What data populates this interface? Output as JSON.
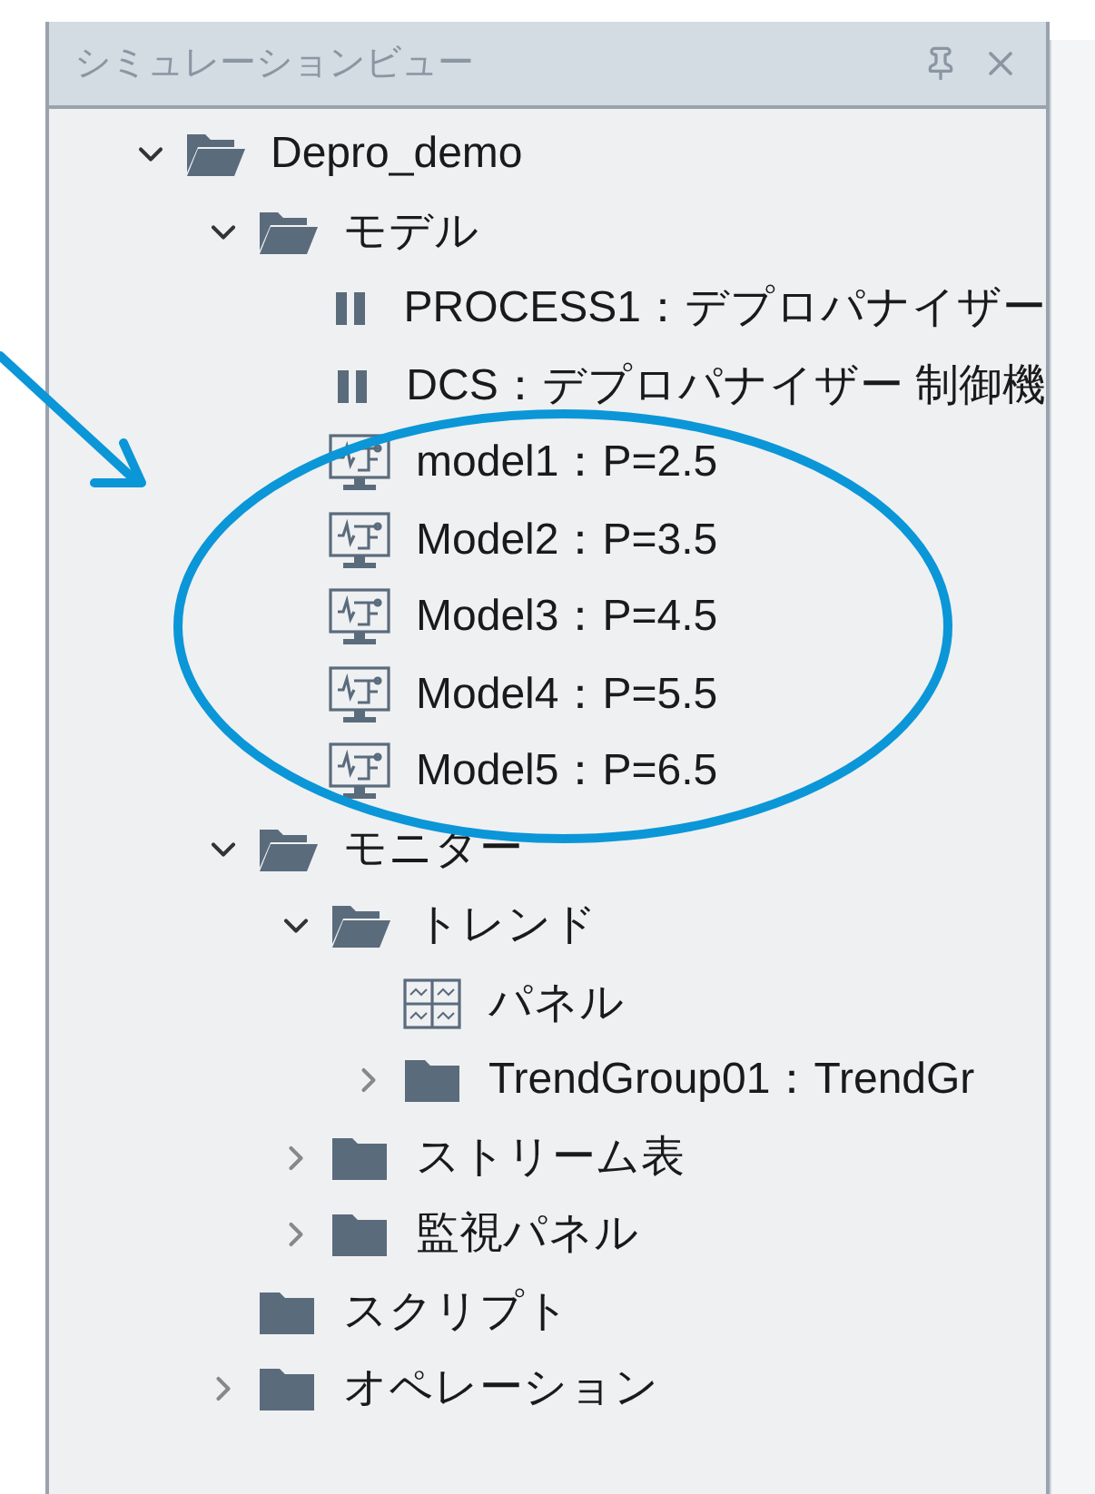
{
  "panel": {
    "title": "シミュレーションビュー"
  },
  "tree": [
    {
      "label": "Depro_demo",
      "kind": "folder",
      "expanded": true,
      "children": [
        {
          "label": "モデル",
          "kind": "folder",
          "expanded": true,
          "children": [
            {
              "label": "PROCESS1：デプロパナイザー",
              "kind": "process"
            },
            {
              "label": "DCS：デプロパナイザー 制御機",
              "kind": "process"
            },
            {
              "label": "model1：P=2.5",
              "kind": "model"
            },
            {
              "label": "Model2：P=3.5",
              "kind": "model"
            },
            {
              "label": "Model3：P=4.5",
              "kind": "model"
            },
            {
              "label": "Model4：P=5.5",
              "kind": "model"
            },
            {
              "label": "Model5：P=6.5",
              "kind": "model"
            }
          ]
        },
        {
          "label": "モニター",
          "kind": "folder",
          "expanded": true,
          "children": [
            {
              "label": "トレンド",
              "kind": "folder",
              "expanded": true,
              "children": [
                {
                  "label": "パネル",
                  "kind": "panel"
                },
                {
                  "label": "TrendGroup01：TrendGr",
                  "kind": "folder",
                  "expanded": false
                }
              ]
            },
            {
              "label": "ストリーム表",
              "kind": "folder",
              "expanded": false
            },
            {
              "label": "監視パネル",
              "kind": "folder",
              "expanded": false
            }
          ]
        },
        {
          "label": "スクリプト",
          "kind": "folder"
        },
        {
          "label": "オペレーション",
          "kind": "folder",
          "expanded": false
        }
      ]
    }
  ]
}
